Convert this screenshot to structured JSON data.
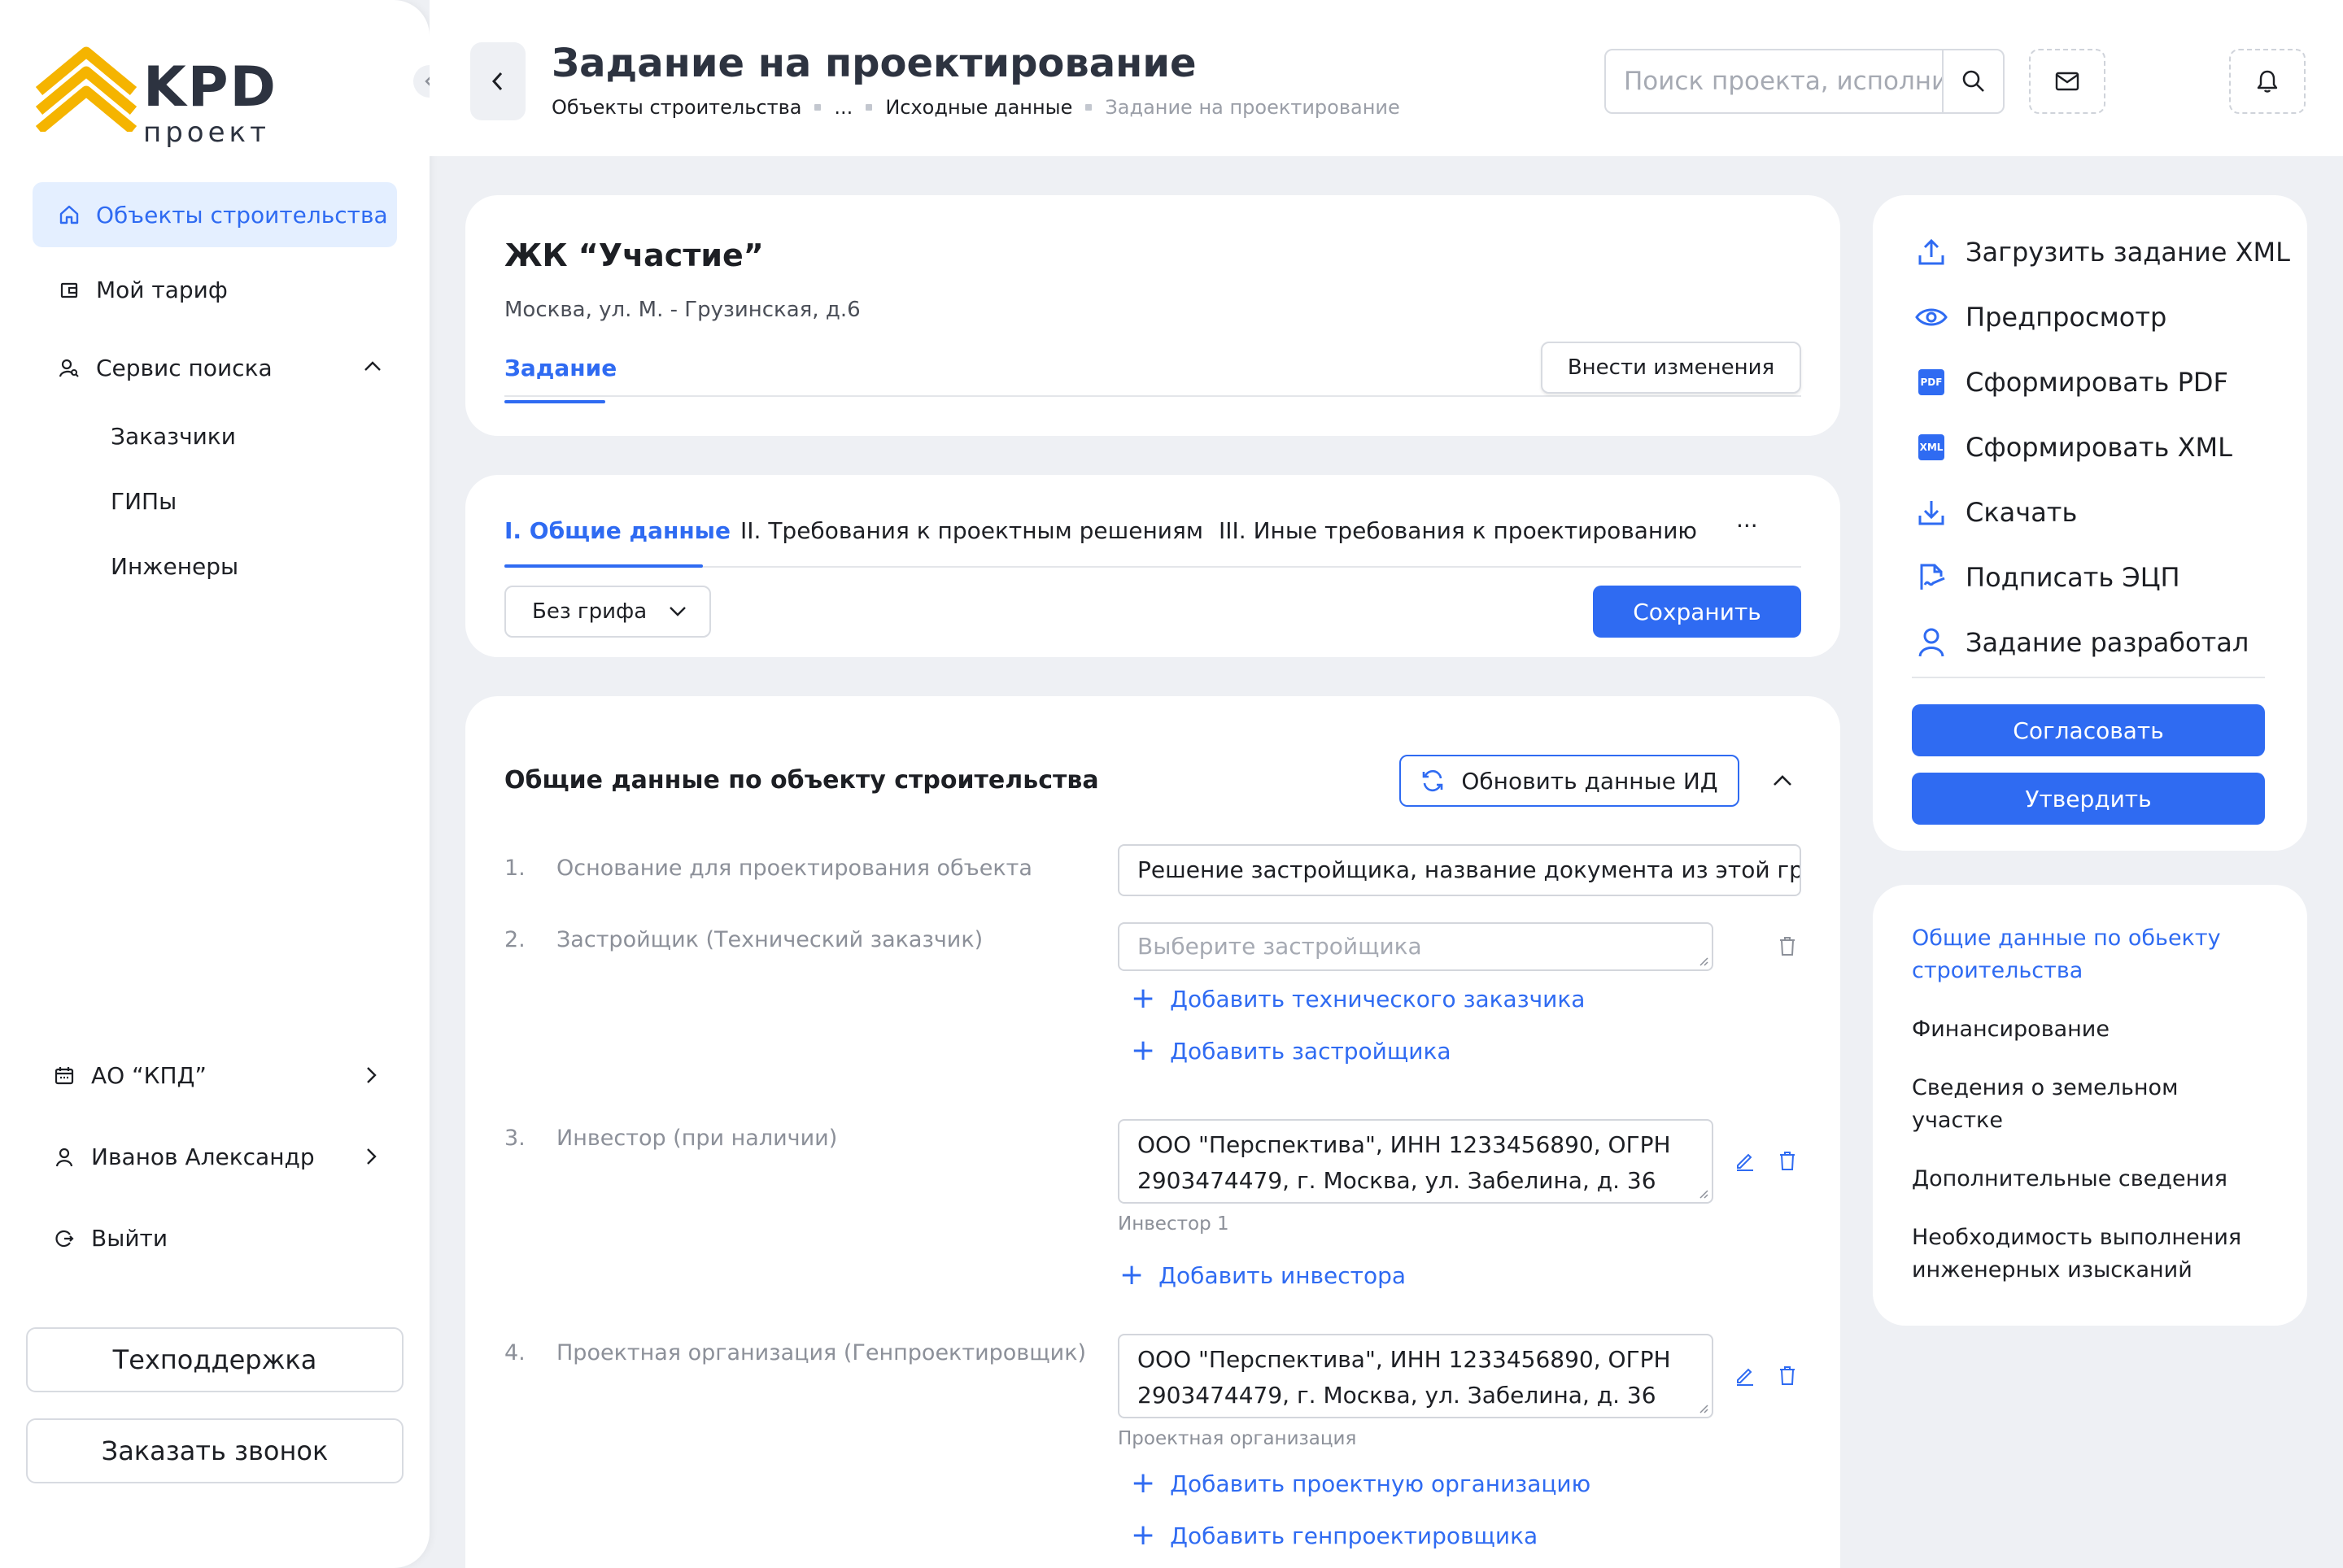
{
  "sidebar": {
    "brand": "KPD",
    "brand_sub": "проект",
    "nav": {
      "objects": "Объекты строительства",
      "tariff": "Мой тариф",
      "search_service": "Сервис поиска",
      "sub": [
        "Заказчики",
        "ГИПы",
        "Инженеры"
      ]
    },
    "company": "АО “КПД”",
    "user": "Иванов Александр",
    "logout": "Выйти",
    "support_button": "Техподдержка",
    "callback_button": "Заказать звонок"
  },
  "header": {
    "title": "Задание на проектирование",
    "breadcrumb": [
      "Объекты строительства",
      "...",
      "Исходные данные",
      "Задание на проектирование"
    ],
    "search_placeholder": "Поиск проекта, исполнителя"
  },
  "project": {
    "name": "ЖК “Участие”",
    "address": "Москва, ул. М. - Грузинская, д.6",
    "tab": "Задание",
    "edit_button": "Внести изменения"
  },
  "sections": {
    "tabs": [
      "I. Общие данные",
      "II. Требования к проектным решениям",
      "III. Иные требования к проектированию"
    ],
    "more": "···",
    "classification": "Без грифа",
    "save_button": "Сохранить"
  },
  "form": {
    "title": "Общие данные по объекту строительства",
    "refresh_button": "Обновить данные ИД",
    "rows": [
      {
        "num": "1.",
        "label": "Основание для проектирования объекта",
        "value": "Решение застройщика, название документа из этой гр..."
      },
      {
        "num": "2.",
        "label": "Застройщик (Технический заказчик)",
        "placeholder": "Выберите застройщика",
        "links": [
          "Добавить технического заказчика",
          "Добавить застройщика"
        ]
      },
      {
        "num": "3.",
        "label": "Инвестор (при наличии)",
        "value_line1": "ООО \"Перспектива\", ИНН 1233456890, ОГРН",
        "value_line2": "2903474479, г. Москва, ул. Забелина, д. 36",
        "hint": "Инвестор 1",
        "links": [
          "Добавить инвестора"
        ]
      },
      {
        "num": "4.",
        "label": "Проектная организация (Генпроектировщик)",
        "value_line1": "ООО \"Перспектива\", ИНН 1233456890, ОГРН",
        "value_line2": "2903474479, г. Москва, ул. Забелина, д. 36",
        "hint": "Проектная организация",
        "links": [
          "Добавить проектную организацию",
          "Добавить генпроектировщика"
        ]
      }
    ]
  },
  "actions": {
    "items": [
      {
        "label": "Загрузить задание XML",
        "icon": "upload-icon"
      },
      {
        "label": "Предпросмотр",
        "icon": "eye-icon"
      },
      {
        "label": "Сформировать PDF",
        "icon": "pdf-icon"
      },
      {
        "label": "Сформировать XML",
        "icon": "xml-icon"
      },
      {
        "label": "Скачать",
        "icon": "download-icon"
      },
      {
        "label": "Подписать ЭЦП",
        "icon": "signature-icon"
      },
      {
        "label": "Задание разработал",
        "icon": "user-icon"
      }
    ],
    "pdf_badge": "PDF",
    "xml_badge": "XML",
    "approve_button": "Согласовать",
    "confirm_button": "Утвердить"
  },
  "toc": {
    "items": [
      "Общие данные по обьекту строительства",
      "Финансирование",
      "Сведения о земельном участке",
      "Дополнительные сведения",
      "Необходимость выполнения инженерных изысканий"
    ]
  },
  "colors": {
    "accent": "#2f6bf2",
    "accent_light": "#e4efff",
    "logo": "#f5b400",
    "background": "#eef0f4"
  }
}
